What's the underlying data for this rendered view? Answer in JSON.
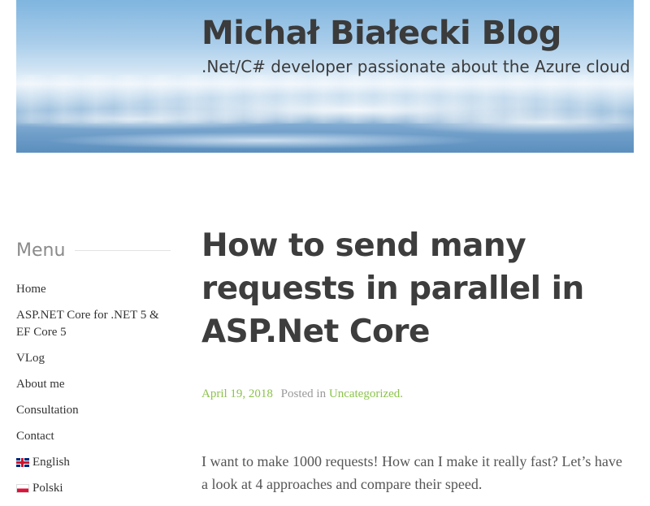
{
  "site": {
    "title": "Michał Białecki Blog",
    "tagline": ".Net/C# developer passionate about the Azure cloud"
  },
  "sidebar": {
    "heading": "Menu",
    "items": [
      {
        "label": "Home"
      },
      {
        "label": "ASP.NET Core for .NET 5 & EF Core 5"
      },
      {
        "label": "VLog"
      },
      {
        "label": "About me"
      },
      {
        "label": "Consultation"
      },
      {
        "label": "Contact"
      },
      {
        "label": "English",
        "flag": "uk-flag-icon"
      },
      {
        "label": "Polski",
        "flag": "pl-flag-icon"
      }
    ]
  },
  "post": {
    "title": "How to send many requests in parallel in ASP.Net Core",
    "date": "April 19, 2018",
    "posted_in": "Posted in",
    "category": "Uncategorized.",
    "excerpt": "I want to make 1000 requests! How can I make it really fast? Let’s have a look at 4 approaches and compare their speed."
  },
  "colors": {
    "accent": "#8cc34b",
    "title_text": "#3d3d3d",
    "muted": "#999999"
  }
}
